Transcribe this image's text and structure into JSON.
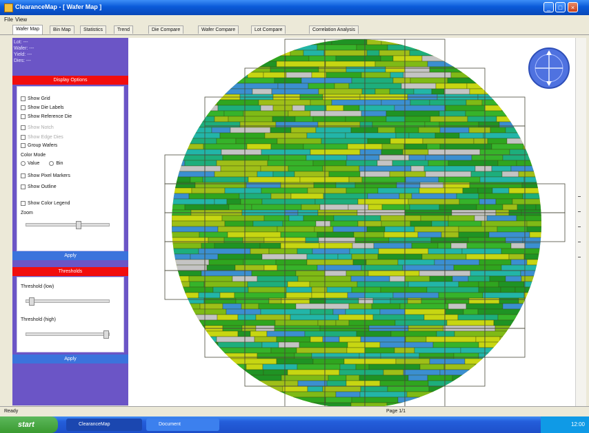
{
  "window": {
    "title": "ClearanceMap - [ Wafer Map ]",
    "minimize_label": "_",
    "maximize_label": "□",
    "close_label": "×"
  },
  "menu": [
    "File",
    "View"
  ],
  "tabs": [
    "Wafer Map",
    "Bin Map",
    "Statistics",
    "Trend",
    "Die Compare",
    "Wafer Compare",
    "Lot Compare",
    "Correlation Analysis"
  ],
  "sidebar": {
    "info_lines": [
      "Lot: ---",
      "Wafer: ---",
      "Yield: ---",
      "Dies: ---"
    ],
    "display_header": "Display Options",
    "options": [
      "Show Grid",
      "Show Die Labels",
      "Show Reference Die",
      "Show Notch",
      "Show Edge Dies",
      "Group Wafers",
      "Show Pixel Markers",
      "Show Outline",
      "Show Color Legend"
    ],
    "radio_label": "Color Mode",
    "radio_options": [
      "Value",
      "Bin"
    ],
    "slider_label": "Zoom",
    "apply_label": "Apply",
    "threshold_header": "Thresholds",
    "threshold_labels": [
      "Threshold (low)",
      "Threshold (high)"
    ],
    "threshold_apply_label": "Apply"
  },
  "status": {
    "left": "Ready",
    "right": "Page 1/1"
  },
  "taskbar": {
    "start_label": "start",
    "tasks": [
      "ClearanceMap",
      "Document"
    ],
    "clock": "12:00"
  },
  "colors": {
    "sidebar": "#6b55c6",
    "section_header": "#f20d0d",
    "section_footer": "#3b73dc",
    "wafer_fill": "#b7c81a",
    "die_palette": [
      "#2fa51f",
      "#1f9324",
      "#36b32a",
      "#7fba16",
      "#c7d612",
      "#1dae7c",
      "#22b5a8",
      "#3b8fd0",
      "#9fbf18"
    ]
  }
}
